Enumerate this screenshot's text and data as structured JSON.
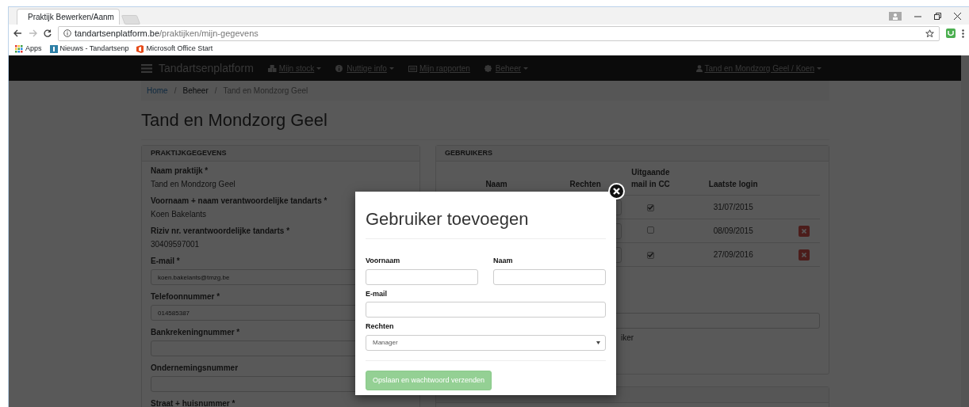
{
  "browser": {
    "tab_title": "Praktijk Bewerken/Aanm",
    "url_host": "tandartsenplatform.be",
    "url_path": "/praktijken/mijn-gegevens",
    "bookmarks": [
      {
        "label": "Apps",
        "kind": "apps"
      },
      {
        "label": "Nieuws - Tandartsenp",
        "kind": "site"
      },
      {
        "label": "Microsoft Office Start",
        "kind": "office"
      }
    ]
  },
  "navbar": {
    "brand": "Tandartsenplatform",
    "items": [
      {
        "label": "Mijn stock",
        "dropdown": true
      },
      {
        "label": "Nuttige info",
        "dropdown": true
      },
      {
        "label": "Mijn rapporten",
        "dropdown": false
      },
      {
        "label": "Beheer",
        "dropdown": true
      }
    ],
    "user": {
      "label": "Tand en Mondzorg Geel / Koen",
      "dropdown": true
    }
  },
  "breadcrumb": {
    "separator": "/",
    "items": [
      {
        "label": "Home",
        "kind": "link"
      },
      {
        "label": "Beheer",
        "kind": "text"
      },
      {
        "label": "Tand en Mondzorg Geel",
        "kind": "current"
      }
    ]
  },
  "page_title": "Tand en Mondzorg Geel",
  "practice_panel": {
    "title": "PRAKTIJKGEGEVENS",
    "fields": [
      {
        "label": "Naam praktijk *",
        "kind": "static",
        "value": "Tand en Mondzorg Geel"
      },
      {
        "label": "Voornaam + naam verantwoordelijke tandarts *",
        "kind": "static",
        "value": "Koen Bakelants"
      },
      {
        "label": "Riziv nr. verantwoordelijke tandarts *",
        "kind": "static",
        "value": "30409597001"
      },
      {
        "label": "E-mail *",
        "kind": "input",
        "value": "koen.bakelants@tmzg.be"
      },
      {
        "label": "Telefoonnummer *",
        "kind": "input",
        "value": "014585387"
      },
      {
        "label": "Bankrekeningnummer *",
        "kind": "input"
      },
      {
        "label": "Ondernemingsnummer",
        "kind": "input"
      },
      {
        "label": "Straat + huisnummer *",
        "kind": "label"
      }
    ]
  },
  "users_panel": {
    "title": "GEBRUIKERS",
    "columns": [
      "Naam",
      "Rechten",
      "Uitgaande mail in CC",
      "Laatste login"
    ],
    "rows": [
      {
        "mail_cc": true,
        "last_login": "31/07/2015",
        "deletable": false
      },
      {
        "mail_cc": false,
        "last_login": "08/09/2015",
        "deletable": true
      },
      {
        "mail_cc": true,
        "last_login": "27/09/2016",
        "deletable": true
      }
    ],
    "hint_fragment": "iker"
  },
  "modal": {
    "title": "Gebruiker toevoegen",
    "fields": [
      {
        "label": "Voornaam",
        "kind": "half"
      },
      {
        "label": "Naam",
        "kind": "half"
      },
      {
        "label": "E-mail",
        "kind": "full"
      },
      {
        "label": "Rechten",
        "kind": "select",
        "value": "Manager"
      }
    ],
    "submit": {
      "label": "Opslaan en wachtwoord verzenden",
      "disabled": true
    }
  }
}
